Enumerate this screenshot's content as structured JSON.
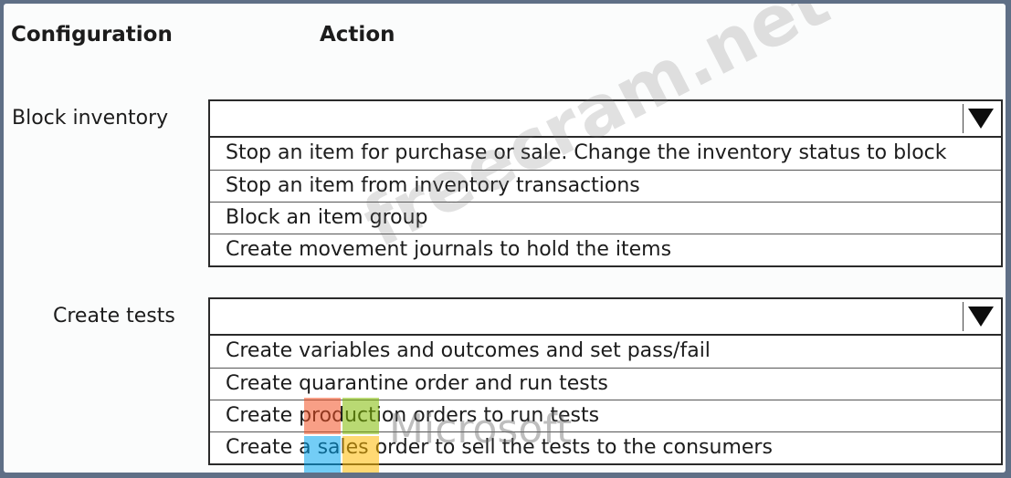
{
  "headers": {
    "configuration": "Configuration",
    "action": "Action"
  },
  "rows": [
    {
      "label": "Block inventory",
      "selected": "",
      "options": [
        "Stop an item for purchase or sale. Change the inventory status to block",
        "Stop an item from inventory transactions",
        "Block an item group",
        "Create movement journals to hold the items"
      ]
    },
    {
      "label": "Create tests",
      "selected": "",
      "options": [
        "Create variables and outcomes and set pass/fail",
        "Create quarantine order and run tests",
        "Create production orders to run tests",
        "Create a sales order to sell the tests to the consumers"
      ]
    }
  ],
  "watermark": {
    "text": "freecram.net",
    "logo_text": "Microsoft"
  },
  "colors": {
    "background": "#5f6f86",
    "panel": "#fbfcfc",
    "border": "#2a2a2a",
    "logo_red": "#f25022",
    "logo_green": "#7fba00",
    "logo_blue": "#00a4ef",
    "logo_yellow": "#ffb900"
  }
}
